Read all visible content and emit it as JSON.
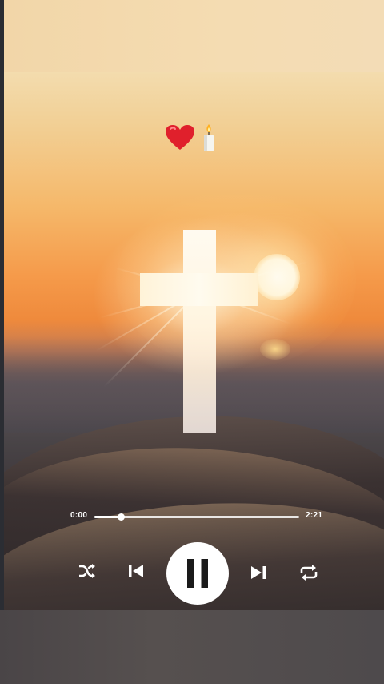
{
  "player": {
    "emoji": {
      "heart": "heart-icon",
      "candle": "candle-icon"
    },
    "progress": {
      "elapsed": "0:00",
      "total": "2:21",
      "fraction": 0.13
    },
    "controls": {
      "shuffle": "shuffle-icon",
      "previous": "skip-previous-icon",
      "play_pause": "pause-icon",
      "next": "skip-next-icon",
      "repeat": "repeat-icon"
    }
  },
  "colors": {
    "sky_top": "#f3dcae",
    "sky_sunset": "#f59a4a",
    "sea": "#2e2a2c",
    "cross": "#fffaf0",
    "controls": "#ffffff",
    "heart": "#e0202c"
  }
}
